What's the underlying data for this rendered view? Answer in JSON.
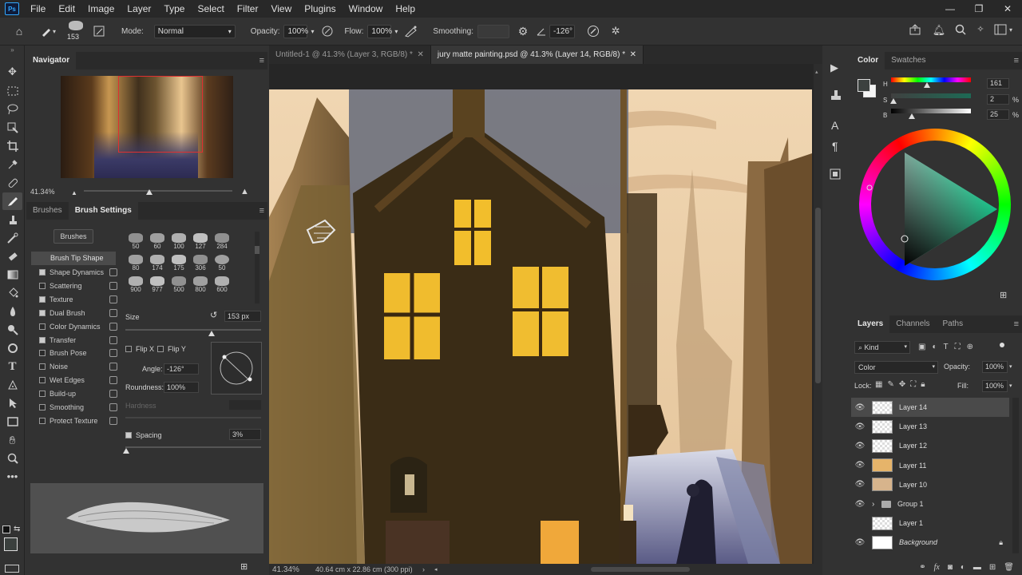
{
  "menubar": {
    "logo": "Ps",
    "items": [
      "File",
      "Edit",
      "Image",
      "Layer",
      "Type",
      "Select",
      "Filter",
      "View",
      "Plugins",
      "Window",
      "Help"
    ]
  },
  "options": {
    "brush_size": "153",
    "mode_label": "Mode:",
    "mode_value": "Normal",
    "opacity_label": "Opacity:",
    "opacity_value": "100%",
    "flow_label": "Flow:",
    "flow_value": "100%",
    "smoothing_label": "Smoothing:",
    "smoothing_value": "",
    "angle_value": "-126°"
  },
  "doc_tabs": [
    "Untitled-1 @ 41.3% (Layer 3, RGB/8) *",
    "jury matte painting.psd @ 41.3% (Layer 14, RGB/8) *"
  ],
  "status": {
    "zoom": "41.34%",
    "info": "40.64 cm x 22.86 cm (300 ppi)"
  },
  "navigator": {
    "title": "Navigator",
    "zoom": "41.34%"
  },
  "brush_panel": {
    "tabs": [
      "Brushes",
      "Brush Settings"
    ],
    "brushes_button": "Brushes",
    "tip_shape": "Brush Tip Shape",
    "settings": [
      {
        "label": "Shape Dynamics",
        "checked": true
      },
      {
        "label": "Scattering",
        "checked": false
      },
      {
        "label": "Texture",
        "checked": true
      },
      {
        "label": "Dual Brush",
        "checked": true
      },
      {
        "label": "Color Dynamics",
        "checked": false
      },
      {
        "label": "Transfer",
        "checked": true
      },
      {
        "label": "Brush Pose",
        "checked": false
      },
      {
        "label": "Noise",
        "checked": false
      },
      {
        "label": "Wet Edges",
        "checked": false
      },
      {
        "label": "Build-up",
        "checked": false
      },
      {
        "label": "Smoothing",
        "checked": false
      },
      {
        "label": "Protect Texture",
        "checked": false
      }
    ],
    "presets": [
      "50",
      "60",
      "100",
      "127",
      "284",
      "80",
      "174",
      "175",
      "306",
      "50",
      "900",
      "977",
      "500",
      "800",
      "600"
    ],
    "size_label": "Size",
    "size_value": "153 px",
    "flipx": "Flip X",
    "flipy": "Flip Y",
    "angle_label": "Angle:",
    "angle_value": "-126°",
    "roundness_label": "Roundness:",
    "roundness_value": "100%",
    "hardness_label": "Hardness",
    "spacing_label": "Spacing",
    "spacing_value": "3%"
  },
  "color_panel": {
    "tabs": [
      "Color",
      "Swatches"
    ],
    "h_label": "H",
    "h_value": "161",
    "s_label": "S",
    "s_value": "2",
    "b_label": "B",
    "b_value": "25",
    "pct": "%"
  },
  "layers_panel": {
    "tabs": [
      "Layers",
      "Channels",
      "Paths"
    ],
    "kind": "Kind",
    "blend": "Color",
    "opacity_label": "Opacity:",
    "opacity_value": "100%",
    "lock_label": "Lock:",
    "fill_label": "Fill:",
    "fill_value": "100%",
    "layers": [
      {
        "name": "Layer 14",
        "visible": true,
        "selected": true
      },
      {
        "name": "Layer 13",
        "visible": true,
        "selected": false
      },
      {
        "name": "Layer 12",
        "visible": true,
        "selected": false
      },
      {
        "name": "Layer 11",
        "visible": true,
        "selected": false
      },
      {
        "name": "Layer 10",
        "visible": true,
        "selected": false
      },
      {
        "name": "Group 1",
        "visible": true,
        "selected": false
      },
      {
        "name": "Layer 1",
        "visible": false,
        "selected": false
      },
      {
        "name": "Background",
        "visible": true,
        "selected": false
      }
    ]
  }
}
